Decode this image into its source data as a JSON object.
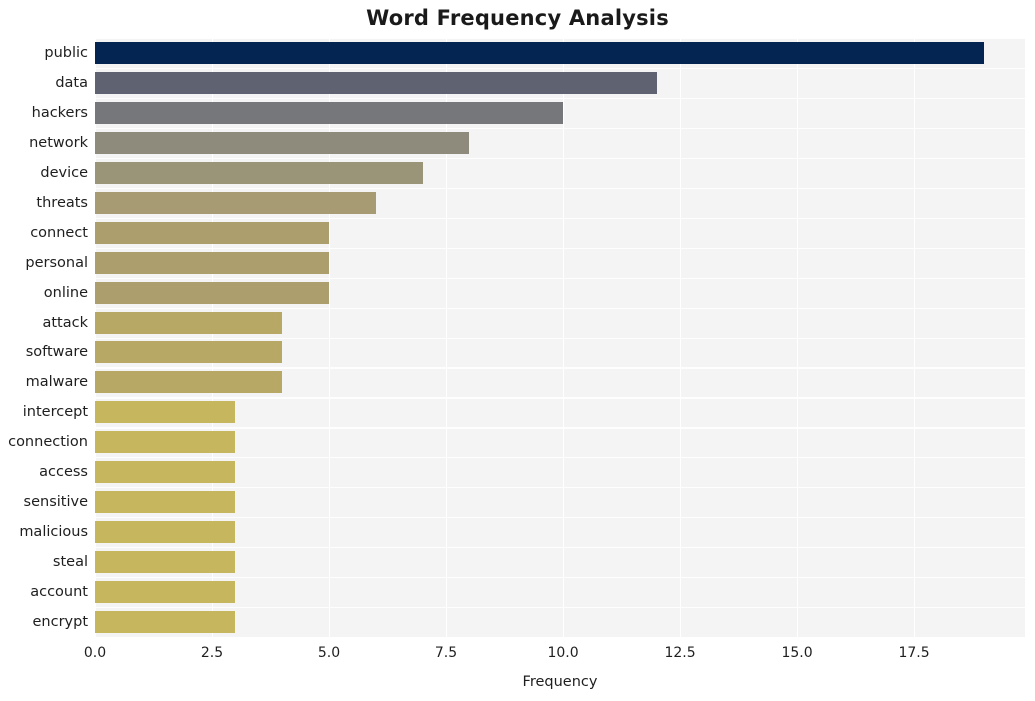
{
  "chart_data": {
    "type": "bar",
    "orientation": "horizontal",
    "title": "Word Frequency Analysis",
    "xlabel": "Frequency",
    "ylabel": "",
    "categories": [
      "public",
      "data",
      "hackers",
      "network",
      "device",
      "threats",
      "connect",
      "personal",
      "online",
      "attack",
      "software",
      "malware",
      "intercept",
      "connection",
      "access",
      "sensitive",
      "malicious",
      "steal",
      "account",
      "encrypt"
    ],
    "values": [
      19,
      12,
      10,
      8,
      7,
      6,
      5,
      5,
      5,
      4,
      4,
      4,
      3,
      3,
      3,
      3,
      3,
      3,
      3,
      3
    ],
    "bar_colors": [
      "#042451",
      "#5e6271",
      "#76777a",
      "#8e8b7c",
      "#9a9478",
      "#a69b72",
      "#ad9f6d",
      "#ad9f6d",
      "#ad9f6d",
      "#b8a866",
      "#b8a866",
      "#b8a866",
      "#c6b75f",
      "#c6b75f",
      "#c6b75f",
      "#c6b75f",
      "#c6b75f",
      "#c6b75f",
      "#c6b75f",
      "#c6b75f"
    ],
    "xticks": [
      "0.0",
      "2.5",
      "5.0",
      "7.5",
      "10.0",
      "12.5",
      "15.0",
      "17.5"
    ],
    "xtick_values": [
      0,
      2.5,
      5,
      7.5,
      10,
      12.5,
      15,
      17.5
    ],
    "xlim": [
      0,
      19.87
    ],
    "grid": true,
    "legend": "none",
    "plot_background": "#f4f4f5",
    "figure_background": "#ffffff",
    "gridline_color": "#ffffff"
  }
}
